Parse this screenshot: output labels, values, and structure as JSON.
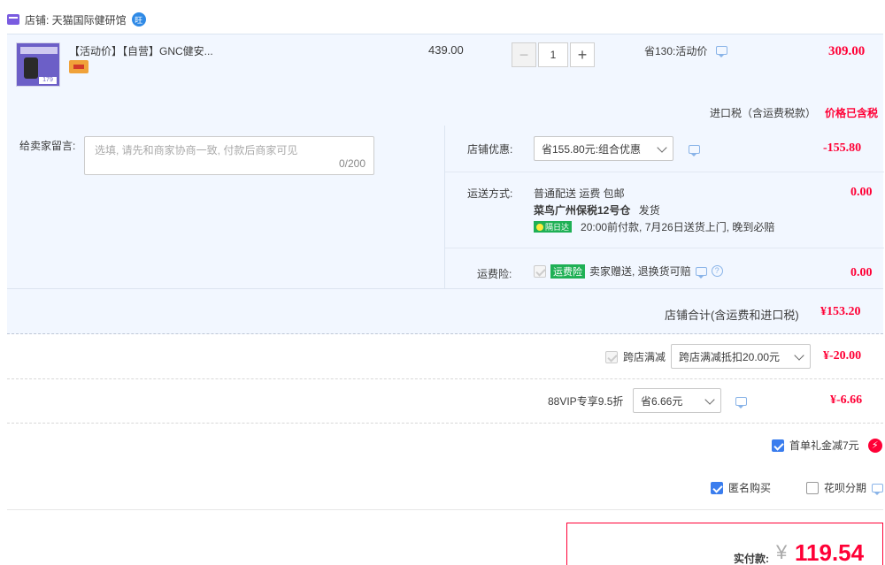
{
  "shop": {
    "label": "店铺: 天猫国际健研馆",
    "ww_text": "旺"
  },
  "product": {
    "thumb_caption": "179",
    "title": "【活动价】【自营】GNC健安...",
    "unit_price": "439.00",
    "quantity": "1",
    "minus": "−",
    "plus": "+",
    "promo": "省130:活动价",
    "subtotal": "309.00",
    "tax_label": "进口税（含运费税款）",
    "tax_value": "价格已含税"
  },
  "message": {
    "label": "给卖家留言:",
    "placeholder": "选填, 请先和商家协商一致, 付款后商家可见",
    "counter": "0/200"
  },
  "shop_discount": {
    "label": "店铺优惠:",
    "selected": "省155.80元:组合优惠",
    "amount": "-155.80"
  },
  "shipping": {
    "label": "运送方式:",
    "line1": "普通配送 运费 包邮",
    "warehouse": "菜鸟广州保税12号仓",
    "dispatch": "发货",
    "badge": "隔日达",
    "eta": "20:00前付款, 7月26日送货上门, 晚到必赔",
    "amount": "0.00"
  },
  "insurance": {
    "label": "运费险:",
    "badge": "运费险",
    "desc": "卖家赠送, 退换货可赔",
    "help": "?",
    "amount": "0.00"
  },
  "shop_total": {
    "label": "店铺合计(含运费和进口税)",
    "amount": "¥153.20"
  },
  "cross_store": {
    "label": "跨店满减",
    "selected": "跨店满减抵扣20.00元",
    "amount": "¥-20.00"
  },
  "vip": {
    "label": "88VIP专享9.5折",
    "selected": "省6.66元",
    "amount": "¥-6.66"
  },
  "first_order": {
    "label": "首单礼金减7元",
    "bolt": "⚡"
  },
  "anonymous": {
    "label": "匿名购买"
  },
  "huabei": {
    "label": "花呗分期"
  },
  "payment": {
    "label": "实付款:",
    "currency": "¥",
    "amount": "119.54"
  }
}
